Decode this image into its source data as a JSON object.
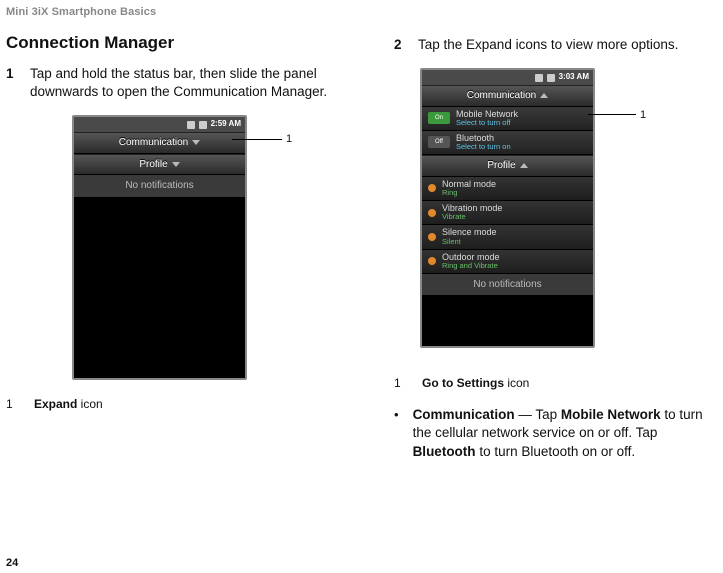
{
  "header": "Mini 3iX Smartphone Basics",
  "page_number": "24",
  "section_title": "Connection Manager",
  "left": {
    "step_num": "1",
    "step_text": "Tap and hold the status bar, then slide the panel downwards to open the Communication Manager.",
    "callout_num": "1",
    "legend_num": "1",
    "legend_text_strong": "Expand",
    "legend_text_rest": " icon",
    "phone": {
      "time": "2:59 AM",
      "communication": "Communication",
      "profile": "Profile",
      "no_notifications": "No notifications"
    }
  },
  "right": {
    "step_num": "2",
    "step_text": "Tap the Expand icons to view more options.",
    "callout_num": "1",
    "legend_num": "1",
    "legend_text_strong": "Go to Settings",
    "legend_text_rest": " icon",
    "bullet_dot": "•",
    "bullet_strong1": "Communication",
    "bullet_mid1": " — Tap ",
    "bullet_strong2": "Mobile Network",
    "bullet_mid2": " to turn the cellular network service on or off. Tap ",
    "bullet_strong3": "Bluetooth",
    "bullet_mid3": " to turn Bluetooth on or off.",
    "phone": {
      "time": "3:03 AM",
      "communication": "Communication",
      "mobile_network": "Mobile Network",
      "mobile_network_sub": "Select to turn off",
      "bluetooth": "Bluetooth",
      "bluetooth_sub": "Select to turn on",
      "profile": "Profile",
      "normal": "Normal mode",
      "normal_sub": "Ring",
      "vibration": "Vibration mode",
      "vibration_sub": "Vibrate",
      "silence": "Silence mode",
      "silence_sub": "Silent",
      "outdoor": "Outdoor mode",
      "outdoor_sub": "Ring and Vibrate",
      "no_notifications": "No notifications",
      "on_label": "On",
      "off_label": "Off"
    }
  }
}
